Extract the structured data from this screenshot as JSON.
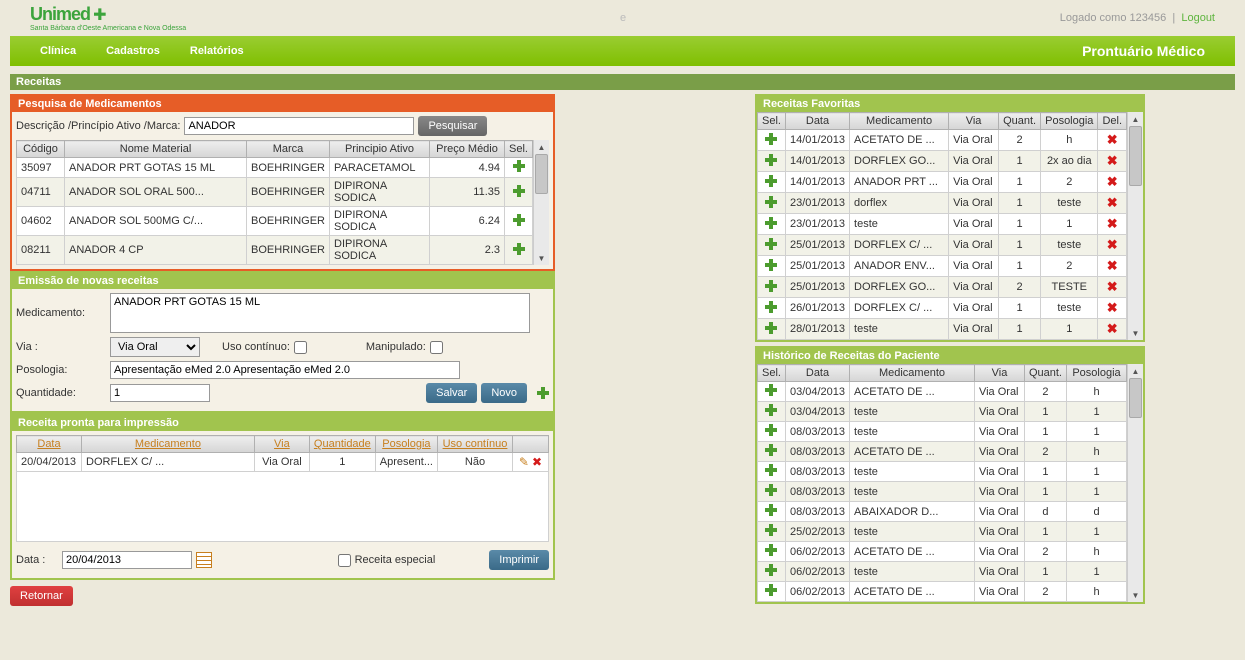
{
  "brand": {
    "name": "Unimed",
    "sub": "Santa Bárbara d'Oeste\nAmericana e Nova Odessa"
  },
  "login": {
    "text": "Logado como 123456",
    "logout": "Logout"
  },
  "menu": {
    "clinica": "Clínica",
    "cadastros": "Cadastros",
    "relatorios": "Relatórios",
    "page": "Prontuário Médico"
  },
  "section_main": "Receitas",
  "search": {
    "title": "Pesquisa de Medicamentos",
    "label": "Descrição /Princípio Ativo /Marca:",
    "value": "ANADOR",
    "button": "Pesquisar",
    "cols": {
      "codigo": "Código",
      "nome": "Nome Material",
      "marca": "Marca",
      "principio": "Principio Ativo",
      "preco": "Preço Médio",
      "sel": "Sel."
    },
    "rows": [
      {
        "codigo": "35097",
        "nome": "ANADOR PRT GOTAS 15 ML",
        "marca": "BOEHRINGER",
        "principio": "PARACETAMOL",
        "preco": "4.94"
      },
      {
        "codigo": "04711",
        "nome": "ANADOR SOL ORAL 500...",
        "marca": "BOEHRINGER",
        "principio": "DIPIRONA SODICA",
        "preco": "11.35"
      },
      {
        "codigo": "04602",
        "nome": "ANADOR SOL 500MG C/...",
        "marca": "BOEHRINGER",
        "principio": "DIPIRONA SODICA",
        "preco": "6.24"
      },
      {
        "codigo": "08211",
        "nome": "ANADOR 4 CP",
        "marca": "BOEHRINGER",
        "principio": "DIPIRONA SODICA",
        "preco": "2.3"
      }
    ]
  },
  "emissao": {
    "title": "Emissão de novas receitas",
    "med_label": "Medicamento:",
    "med_value": "ANADOR PRT GOTAS 15 ML",
    "via_label": "Via :",
    "via_value": "Via Oral",
    "uso_label": "Uso contínuo:",
    "manip_label": "Manipulado:",
    "pos_label": "Posologia:",
    "pos_value": "Apresentação eMed 2.0 Apresentação eMed 2.0",
    "qtd_label": "Quantidade:",
    "qtd_value": "1",
    "salvar": "Salvar",
    "novo": "Novo"
  },
  "pronta": {
    "title": "Receita pronta para impressão",
    "cols": {
      "data": "Data",
      "med": "Medicamento",
      "via": "Via",
      "qtd": "Quantidade",
      "pos": "Posologia",
      "uso": "Uso contínuo"
    },
    "rows": [
      {
        "data": "20/04/2013",
        "med": "DORFLEX C/ ...",
        "via": "Via Oral",
        "qtd": "1",
        "pos": "Apresent...",
        "uso": "Não"
      }
    ],
    "data_label": "Data :",
    "data_value": "20/04/2013",
    "especial_label": "Receita especial",
    "imprimir": "Imprimir"
  },
  "retornar": "Retornar",
  "favoritas": {
    "title": "Receitas Favoritas",
    "cols": {
      "sel": "Sel.",
      "data": "Data",
      "med": "Medicamento",
      "via": "Via",
      "qtd": "Quant.",
      "pos": "Posologia",
      "del": "Del."
    },
    "rows": [
      {
        "data": "14/01/2013",
        "med": "ACETATO DE ...",
        "via": "Via Oral",
        "qtd": "2",
        "pos": "h"
      },
      {
        "data": "14/01/2013",
        "med": "DORFLEX GO...",
        "via": "Via Oral",
        "qtd": "1",
        "pos": "2x ao dia"
      },
      {
        "data": "14/01/2013",
        "med": "ANADOR PRT ...",
        "via": "Via Oral",
        "qtd": "1",
        "pos": "2"
      },
      {
        "data": "23/01/2013",
        "med": "dorflex",
        "via": "Via Oral",
        "qtd": "1",
        "pos": "teste"
      },
      {
        "data": "23/01/2013",
        "med": "teste",
        "via": "Via Oral",
        "qtd": "1",
        "pos": "1"
      },
      {
        "data": "25/01/2013",
        "med": "DORFLEX C/ ...",
        "via": "Via Oral",
        "qtd": "1",
        "pos": "teste"
      },
      {
        "data": "25/01/2013",
        "med": "ANADOR ENV...",
        "via": "Via Oral",
        "qtd": "1",
        "pos": "2"
      },
      {
        "data": "25/01/2013",
        "med": "DORFLEX GO...",
        "via": "Via Oral",
        "qtd": "2",
        "pos": "TESTE"
      },
      {
        "data": "26/01/2013",
        "med": "DORFLEX C/ ...",
        "via": "Via Oral",
        "qtd": "1",
        "pos": "teste"
      },
      {
        "data": "28/01/2013",
        "med": "teste",
        "via": "Via Oral",
        "qtd": "1",
        "pos": "1"
      }
    ]
  },
  "historico": {
    "title": "Histórico de Receitas do Paciente",
    "cols": {
      "sel": "Sel.",
      "data": "Data",
      "med": "Medicamento",
      "via": "Via",
      "qtd": "Quant.",
      "pos": "Posologia"
    },
    "rows": [
      {
        "data": "03/04/2013",
        "med": "ACETATO DE ...",
        "via": "Via Oral",
        "qtd": "2",
        "pos": "h"
      },
      {
        "data": "03/04/2013",
        "med": "teste",
        "via": "Via Oral",
        "qtd": "1",
        "pos": "1"
      },
      {
        "data": "08/03/2013",
        "med": "teste",
        "via": "Via Oral",
        "qtd": "1",
        "pos": "1"
      },
      {
        "data": "08/03/2013",
        "med": "ACETATO DE ...",
        "via": "Via Oral",
        "qtd": "2",
        "pos": "h"
      },
      {
        "data": "08/03/2013",
        "med": "teste",
        "via": "Via Oral",
        "qtd": "1",
        "pos": "1"
      },
      {
        "data": "08/03/2013",
        "med": "teste",
        "via": "Via Oral",
        "qtd": "1",
        "pos": "1"
      },
      {
        "data": "08/03/2013",
        "med": "ABAIXADOR D...",
        "via": "Via Oral",
        "qtd": "d",
        "pos": "d"
      },
      {
        "data": "25/02/2013",
        "med": "teste",
        "via": "Via Oral",
        "qtd": "1",
        "pos": "1"
      },
      {
        "data": "06/02/2013",
        "med": "ACETATO DE ...",
        "via": "Via Oral",
        "qtd": "2",
        "pos": "h"
      },
      {
        "data": "06/02/2013",
        "med": "teste",
        "via": "Via Oral",
        "qtd": "1",
        "pos": "1"
      },
      {
        "data": "06/02/2013",
        "med": "ACETATO DE ...",
        "via": "Via Oral",
        "qtd": "2",
        "pos": "h"
      }
    ]
  }
}
